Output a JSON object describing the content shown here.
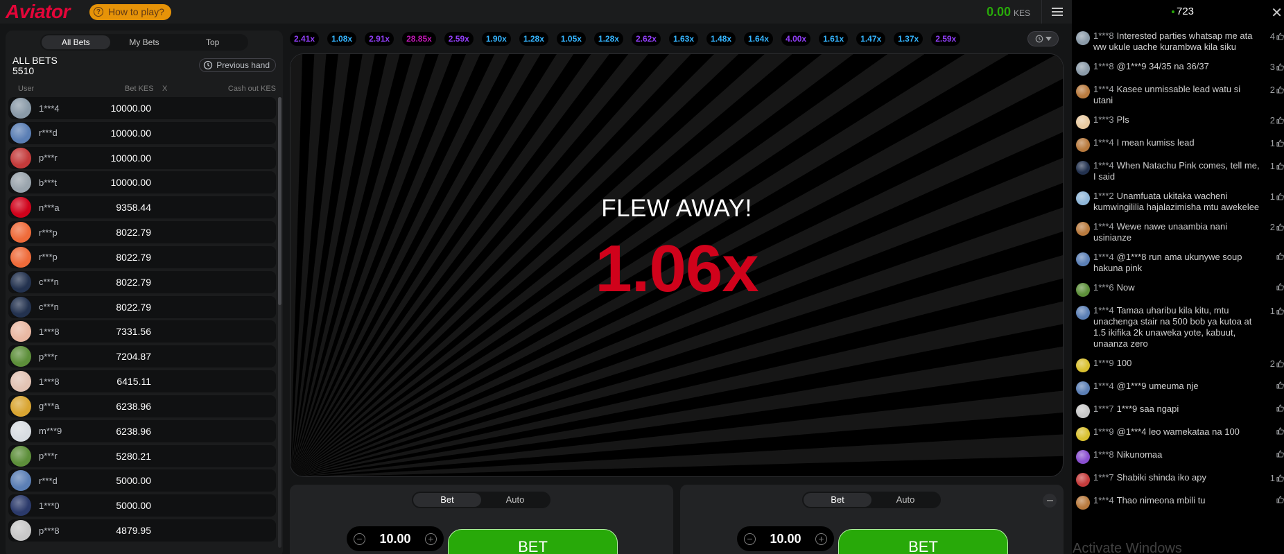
{
  "header": {
    "logo": "Aviator",
    "how_to_play": "How to play?",
    "balance": "0.00",
    "currency": "KES"
  },
  "left_panel": {
    "tabs": [
      "All Bets",
      "My Bets",
      "Top"
    ],
    "active_tab": "All Bets",
    "title": "ALL BETS",
    "count": "5510",
    "previous_hand": "Previous hand",
    "columns": {
      "user": "User",
      "bet": "Bet KES",
      "x": "X",
      "cashout": "Cash out KES"
    },
    "rows": [
      {
        "user": "1***4",
        "bet": "10000.00",
        "avatar_color": "#8a9aa8"
      },
      {
        "user": "r***d",
        "bet": "10000.00",
        "avatar_color": "#5b7fb5"
      },
      {
        "user": "p***r",
        "bet": "10000.00",
        "avatar_color": "#c43b3b"
      },
      {
        "user": "b***t",
        "bet": "10000.00",
        "avatar_color": "#9aa4ad"
      },
      {
        "user": "n***a",
        "bet": "9358.44",
        "avatar_color": "#d0021b"
      },
      {
        "user": "r***p",
        "bet": "8022.79",
        "avatar_color": "#ef6b3a"
      },
      {
        "user": "r***p",
        "bet": "8022.79",
        "avatar_color": "#ef6b3a"
      },
      {
        "user": "c***n",
        "bet": "8022.79",
        "avatar_color": "#23324f"
      },
      {
        "user": "c***n",
        "bet": "8022.79",
        "avatar_color": "#23324f"
      },
      {
        "user": "1***8",
        "bet": "7331.56",
        "avatar_color": "#e9b8a3"
      },
      {
        "user": "p***r",
        "bet": "7204.87",
        "avatar_color": "#5d8f3a"
      },
      {
        "user": "1***8",
        "bet": "6415.11",
        "avatar_color": "#e2c3b4"
      },
      {
        "user": "g***a",
        "bet": "6238.96",
        "avatar_color": "#d9a532"
      },
      {
        "user": "m***9",
        "bet": "6238.96",
        "avatar_color": "#d8dde2"
      },
      {
        "user": "p***r",
        "bet": "5280.21",
        "avatar_color": "#5d8f3a"
      },
      {
        "user": "r***d",
        "bet": "5000.00",
        "avatar_color": "#5b7fb5"
      },
      {
        "user": "1***0",
        "bet": "5000.00",
        "avatar_color": "#2b3a6b"
      },
      {
        "user": "p***8",
        "bet": "4879.95",
        "avatar_color": "#c8c8c8"
      }
    ]
  },
  "multipliers": [
    {
      "v": "2.41x",
      "c": "#913ef8"
    },
    {
      "v": "1.08x",
      "c": "#34b4ff"
    },
    {
      "v": "2.91x",
      "c": "#913ef8"
    },
    {
      "v": "28.85x",
      "c": "#c017b4"
    },
    {
      "v": "2.59x",
      "c": "#913ef8"
    },
    {
      "v": "1.90x",
      "c": "#34b4ff"
    },
    {
      "v": "1.28x",
      "c": "#34b4ff"
    },
    {
      "v": "1.05x",
      "c": "#34b4ff"
    },
    {
      "v": "1.28x",
      "c": "#34b4ff"
    },
    {
      "v": "2.62x",
      "c": "#913ef8"
    },
    {
      "v": "1.63x",
      "c": "#34b4ff"
    },
    {
      "v": "1.48x",
      "c": "#34b4ff"
    },
    {
      "v": "1.64x",
      "c": "#34b4ff"
    },
    {
      "v": "4.00x",
      "c": "#913ef8"
    },
    {
      "v": "1.61x",
      "c": "#34b4ff"
    },
    {
      "v": "1.47x",
      "c": "#34b4ff"
    },
    {
      "v": "1.37x",
      "c": "#34b4ff"
    },
    {
      "v": "2.59x",
      "c": "#913ef8"
    }
  ],
  "game": {
    "status": "FLEW AWAY!",
    "multiplier": "1.06x",
    "multiplier_color": "#d0021b"
  },
  "bet_panels": [
    {
      "tabs": [
        "Bet",
        "Auto"
      ],
      "active": "Bet",
      "amount": "10.00",
      "button": "BET"
    },
    {
      "tabs": [
        "Bet",
        "Auto"
      ],
      "active": "Bet",
      "amount": "10.00",
      "button": "BET"
    }
  ],
  "chat": {
    "online": "723",
    "messages": [
      {
        "user": "1***8",
        "text": "Interested parties whatsap me ata ww ukule uache kurambwa kila siku",
        "likes": "4",
        "color": "#8a9aa8"
      },
      {
        "user": "1***8",
        "text": "@1***9 34/35 na 36/37",
        "likes": "3",
        "color": "#8a9aa8"
      },
      {
        "user": "1***4",
        "text": "Kasee unmissable lead watu si utani",
        "likes": "2",
        "color": "#b87a3e"
      },
      {
        "user": "1***3",
        "text": "Pls",
        "likes": "2",
        "color": "#e8c9a0"
      },
      {
        "user": "1***4",
        "text": "I mean kumiss lead",
        "likes": "1",
        "color": "#b87a3e"
      },
      {
        "user": "1***4",
        "text": "When Natachu Pink comes, tell me, I said",
        "likes": "1",
        "color": "#23324f"
      },
      {
        "user": "1***2",
        "text": "Unamfuata ukitaka wacheni kumwingililia hajalazimisha mtu awekelee",
        "likes": "1",
        "color": "#8fb6d8"
      },
      {
        "user": "1***4",
        "text": "Wewe nawe unaambia nani usinianze",
        "likes": "2",
        "color": "#b87a3e"
      },
      {
        "user": "1***4",
        "text": "@1***8 run ama ukunywe soup hakuna pink",
        "likes": "",
        "color": "#5b7fb5"
      },
      {
        "user": "1***6",
        "text": "Now",
        "likes": "",
        "color": "#5d8f3a"
      },
      {
        "user": "1***4",
        "text": "Tamaa uharibu kila kitu, mtu unachenga stair na 500 bob ya kutoa at 1.5 ikifika 2k unaweka yote, kabuut, unaanza zero",
        "likes": "1",
        "color": "#5b7fb5"
      },
      {
        "user": "1***9",
        "text": "100",
        "likes": "2",
        "color": "#d9c030"
      },
      {
        "user": "1***4",
        "text": "@1***9 umeuma nje",
        "likes": "",
        "color": "#5b7fb5"
      },
      {
        "user": "1***7",
        "text": "1***9 saa ngapi",
        "likes": "",
        "color": "#c8c8c8"
      },
      {
        "user": "1***9",
        "text": "@1***4 leo wamekataa na 100",
        "likes": "",
        "color": "#d9c030"
      },
      {
        "user": "1***8",
        "text": "Nikunomaa",
        "likes": "",
        "color": "#8a4fd0"
      },
      {
        "user": "1***7",
        "text": "Shabiki shinda iko apy",
        "likes": "1",
        "color": "#c43b3b"
      },
      {
        "user": "1***4",
        "text": "Thao nimeona mbili tu",
        "likes": "",
        "color": "#b87a3e"
      }
    ]
  },
  "watermark": "Activate Windows"
}
